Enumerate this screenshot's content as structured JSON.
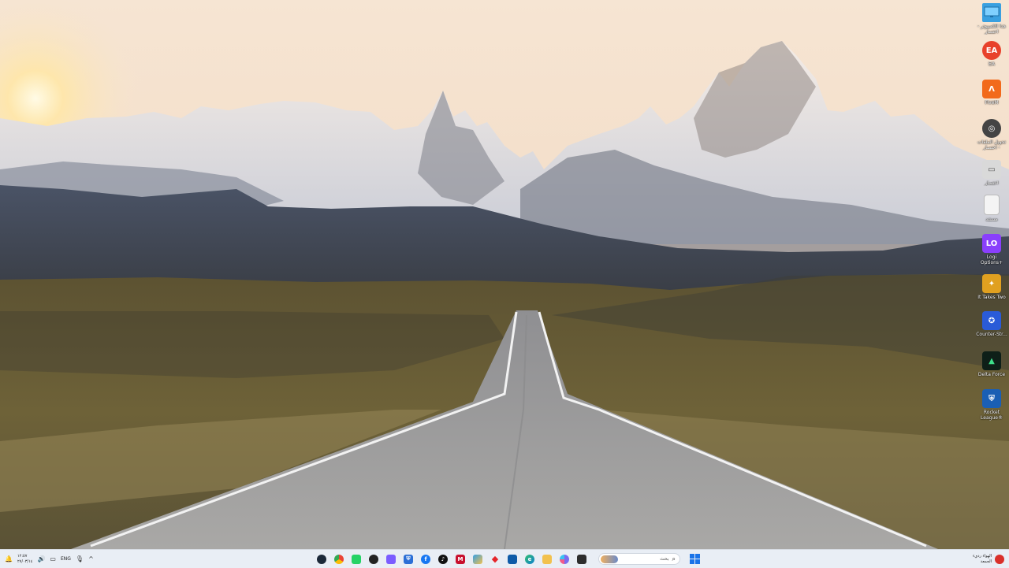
{
  "desktop": {
    "icons": [
      {
        "label": "هذا الكمبيوتر - اختصار",
        "icon": "monitor-icon",
        "color": "#3aa0e0"
      },
      {
        "label": "EA",
        "icon": "ea-logo-icon",
        "color": "#e8412b",
        "glyph": "EA"
      },
      {
        "label": "FiveM",
        "icon": "fivem-logo-icon",
        "color": "#f26a1b",
        "glyph": "Λ"
      },
      {
        "label": "تحويل الملفات - اختصار",
        "icon": "circle-logo-icon",
        "color": "#444444",
        "glyph": "◎"
      },
      {
        "label": "اختصار",
        "icon": "document-shortcut-icon",
        "color": "#d9d9d9",
        "glyph": "▭"
      },
      {
        "label": "مستند",
        "icon": "blank-document-icon",
        "color": "#f4f4f4",
        "glyph": ""
      },
      {
        "label": "Logi Options+",
        "icon": "logi-options-icon",
        "color": "#8a3ffc",
        "glyph": "LO"
      },
      {
        "label": "It Takes Two",
        "icon": "it-takes-two-icon",
        "color": "#e0a020",
        "glyph": "✦"
      },
      {
        "label": "Counter-Str...",
        "icon": "counter-strike-icon",
        "color": "#f0a020",
        "glyph": "✪"
      },
      {
        "label": "Delta Force",
        "icon": "delta-force-icon",
        "color": "#18a060",
        "glyph": "▲"
      },
      {
        "label": "Rocket League®",
        "icon": "rocket-league-icon",
        "color": "#1a5fb4",
        "glyph": "⛨"
      }
    ]
  },
  "taskbar": {
    "tray": {
      "time": "١٢:٥٧",
      "date": "٢٧/٠٣/١٤",
      "language": "ENG",
      "chevron": "^"
    },
    "apps": [
      {
        "name": "steam",
        "icon": "steam-icon",
        "color": "#1b2838",
        "glyph": "●"
      },
      {
        "name": "chrome",
        "icon": "chrome-icon",
        "color": "#ea4335",
        "glyph": "●"
      },
      {
        "name": "whatsapp",
        "icon": "whatsapp-icon",
        "color": "#25d366",
        "glyph": "●"
      },
      {
        "name": "chatgpt",
        "icon": "chatgpt-icon",
        "color": "#222222",
        "glyph": "●"
      },
      {
        "name": "app-purple",
        "icon": "purple-app-icon",
        "color": "#7b5cff",
        "glyph": "●"
      },
      {
        "name": "defender",
        "icon": "shield-icon",
        "color": "#2b6fd6",
        "glyph": "⛨"
      },
      {
        "name": "facebook",
        "icon": "facebook-icon",
        "color": "#1877f2",
        "glyph": "f"
      },
      {
        "name": "tiktok",
        "icon": "tiktok-icon",
        "color": "#111111",
        "glyph": "♪"
      },
      {
        "name": "mcafee",
        "icon": "mcafee-icon",
        "color": "#c8102e",
        "glyph": "M"
      },
      {
        "name": "photos",
        "icon": "photos-icon",
        "color": "#36a0e6",
        "glyph": "●"
      },
      {
        "name": "app-red",
        "icon": "red-diamond-icon",
        "color": "#e5252a",
        "glyph": "◆"
      },
      {
        "name": "store",
        "icon": "store-icon",
        "color": "#0e5ba8",
        "glyph": "■"
      },
      {
        "name": "edge",
        "icon": "edge-icon",
        "color": "#0c7fcf",
        "glyph": "e"
      },
      {
        "name": "explorer",
        "icon": "folder-icon",
        "color": "#f2c14e",
        "glyph": "■"
      },
      {
        "name": "copilot",
        "icon": "copilot-icon",
        "color": "#7a6cf0",
        "glyph": "●"
      },
      {
        "name": "terminal",
        "icon": "terminal-icon",
        "color": "#2d2d2d",
        "glyph": "▪"
      }
    ],
    "search": {
      "placeholder": "بحث"
    },
    "weather": {
      "line1": "الهواء رديء",
      "line2": "الجمعة"
    }
  }
}
